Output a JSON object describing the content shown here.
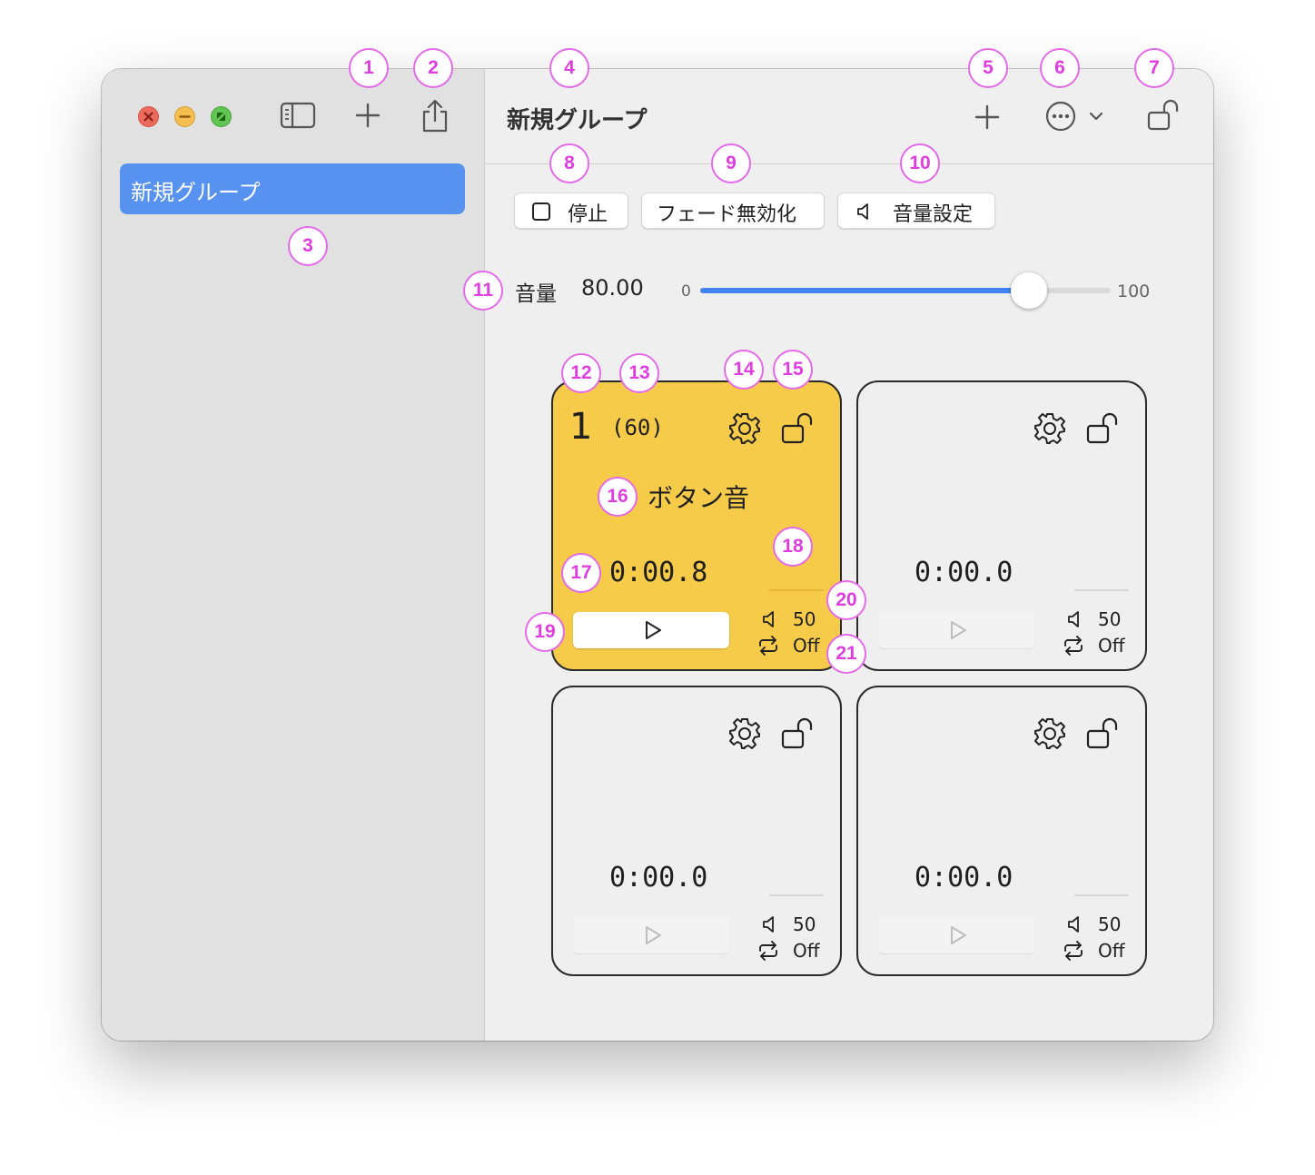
{
  "sidebar": {
    "items": [
      {
        "label": "新規グループ"
      }
    ]
  },
  "header": {
    "title": "新規グループ"
  },
  "toolbar": {
    "stop_label": "停止",
    "fade_label": "フェード無効化",
    "volume_setting_label": "音量設定"
  },
  "volume": {
    "label": "音量",
    "value": "80.00",
    "value_numeric": 80,
    "min": "0",
    "max": "100"
  },
  "cells": [
    {
      "number": "1",
      "duration": "(60)",
      "name": "ボタン音",
      "time": "0:00.8",
      "volume": "50",
      "loop": "Off",
      "active": true
    },
    {
      "number": "",
      "duration": "",
      "name": "",
      "time": "0:00.0",
      "volume": "50",
      "loop": "Off",
      "active": false
    },
    {
      "number": "",
      "duration": "",
      "name": "",
      "time": "0:00.0",
      "volume": "50",
      "loop": "Off",
      "active": false
    },
    {
      "number": "",
      "duration": "",
      "name": "",
      "time": "0:00.0",
      "volume": "50",
      "loop": "Off",
      "active": false
    }
  ],
  "badges": [
    "1",
    "2",
    "3",
    "4",
    "5",
    "6",
    "7",
    "8",
    "9",
    "10",
    "11",
    "12",
    "13",
    "14",
    "15",
    "16",
    "17",
    "18",
    "19",
    "20",
    "21"
  ],
  "colors": {
    "accent": "#3f82f0",
    "sidebar_selection": "#5792f1",
    "active_cell": "#f7cb4a",
    "badge": "#e03de0"
  },
  "icons": [
    "close-icon",
    "minimize-icon",
    "fullscreen-icon",
    "sidebar-toggle-icon",
    "plus-icon",
    "share-icon",
    "more-icon",
    "chevron-down-icon",
    "lock-open-icon",
    "stop-icon",
    "speaker-icon",
    "gear-icon",
    "play-icon",
    "repeat-icon"
  ]
}
